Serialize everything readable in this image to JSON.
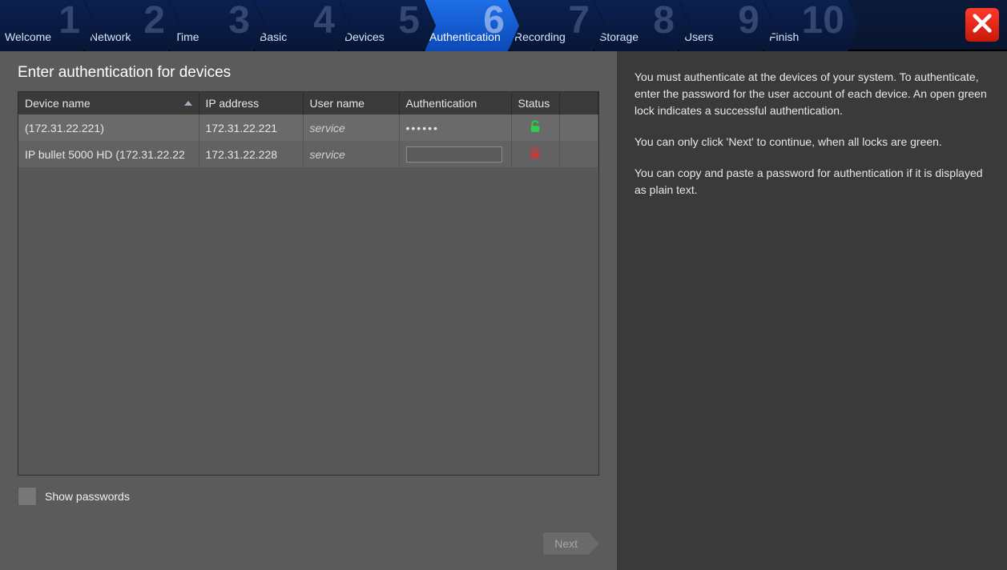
{
  "steps": [
    {
      "num": "1",
      "label": "Welcome"
    },
    {
      "num": "2",
      "label": "Network"
    },
    {
      "num": "3",
      "label": "Time"
    },
    {
      "num": "4",
      "label": "Basic"
    },
    {
      "num": "5",
      "label": "Devices"
    },
    {
      "num": "6",
      "label": "Authentication"
    },
    {
      "num": "7",
      "label": "Recording"
    },
    {
      "num": "8",
      "label": "Storage"
    },
    {
      "num": "9",
      "label": "Users"
    },
    {
      "num": "10",
      "label": "Finish"
    }
  ],
  "active_step_index": 5,
  "heading": "Enter authentication for devices",
  "columns": {
    "device": "Device name",
    "ip": "IP address",
    "user": "User name",
    "auth": "Authentication",
    "status": "Status"
  },
  "rows": [
    {
      "device": " (172.31.22.221)",
      "ip": "172.31.22.221",
      "user": "service",
      "password_masked": "••••••",
      "status": "unlocked"
    },
    {
      "device": "IP bullet 5000 HD (172.31.22.22",
      "ip": "172.31.22.228",
      "user": "service",
      "password_masked": "",
      "status": "locked"
    }
  ],
  "show_passwords_label": "Show passwords",
  "next_label": "Next",
  "help": {
    "p1": "You must authenticate at the devices of your system. To authenticate, enter the password for the user account of each device. An open green lock indicates a successful authentication.",
    "p2": "You can only click 'Next' to continue, when all locks are green.",
    "p3": "You can copy and paste a password for authentication if it is displayed as plain text."
  },
  "colors": {
    "lock_open": "#2dd04a",
    "lock_closed": "#c83a3a"
  }
}
